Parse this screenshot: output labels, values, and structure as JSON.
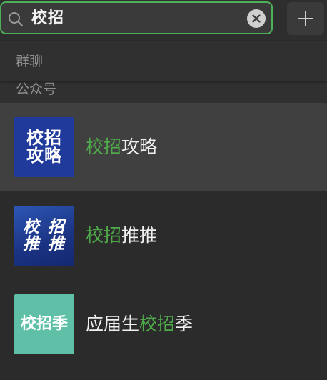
{
  "search": {
    "query": "校招",
    "clear_icon": "clear-icon",
    "search_icon": "search-icon",
    "add_icon": "plus-icon"
  },
  "sections": {
    "group_chats": "群聊",
    "public_accounts": "公众号"
  },
  "results": [
    {
      "avatar_lines": [
        "校招",
        "攻略"
      ],
      "name_pre": "",
      "name_hl": "校招",
      "name_post": "攻略",
      "selected": true
    },
    {
      "avatar_lines": [
        "校 招",
        "推 推"
      ],
      "name_pre": "",
      "name_hl": "校招",
      "name_post": "推推",
      "selected": false
    },
    {
      "avatar_lines": [
        "校招季"
      ],
      "name_pre": "应届生",
      "name_hl": "校招",
      "name_post": "季",
      "selected": false
    }
  ],
  "colors": {
    "accent": "#4faa4a",
    "background": "#2b2b2b",
    "selected_row": "#404040"
  }
}
